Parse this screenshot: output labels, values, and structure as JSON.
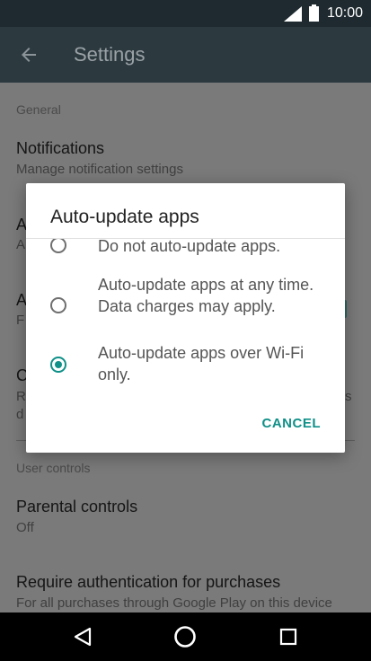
{
  "status": {
    "time": "10:00"
  },
  "appbar": {
    "title": "Settings"
  },
  "settings": {
    "section_general": "General",
    "notifications_title": "Notifications",
    "notifications_sub": "Manage notification settings",
    "peek_1_title": "A",
    "peek_1_sub": "A",
    "peek_2_title": "A",
    "peek_2_sub": "F",
    "peek_3_title": "C",
    "peek_3_sub_a": "R",
    "peek_3_sub_b": "d",
    "peek_3_right": "s",
    "section_user": "User controls",
    "parental_title": "Parental controls",
    "parental_sub": "Off",
    "auth_title": "Require authentication for purchases",
    "auth_sub": "For all purchases through Google Play on this device"
  },
  "dialog": {
    "title": "Auto-update apps",
    "options": [
      {
        "label": "Do not auto-update apps.",
        "checked": false
      },
      {
        "label": "Auto-update apps at any time. Data charges may apply.",
        "checked": false
      },
      {
        "label": "Auto-update apps over Wi-Fi only.",
        "checked": true
      }
    ],
    "cancel_label": "CANCEL",
    "accent_color": "#0f9088"
  },
  "icons": {
    "signal": "signal-icon",
    "battery": "battery-icon",
    "back": "arrow-back-icon",
    "nav_back": "triangle-back-icon",
    "nav_home": "circle-home-icon",
    "nav_recents": "square-recents-icon"
  }
}
